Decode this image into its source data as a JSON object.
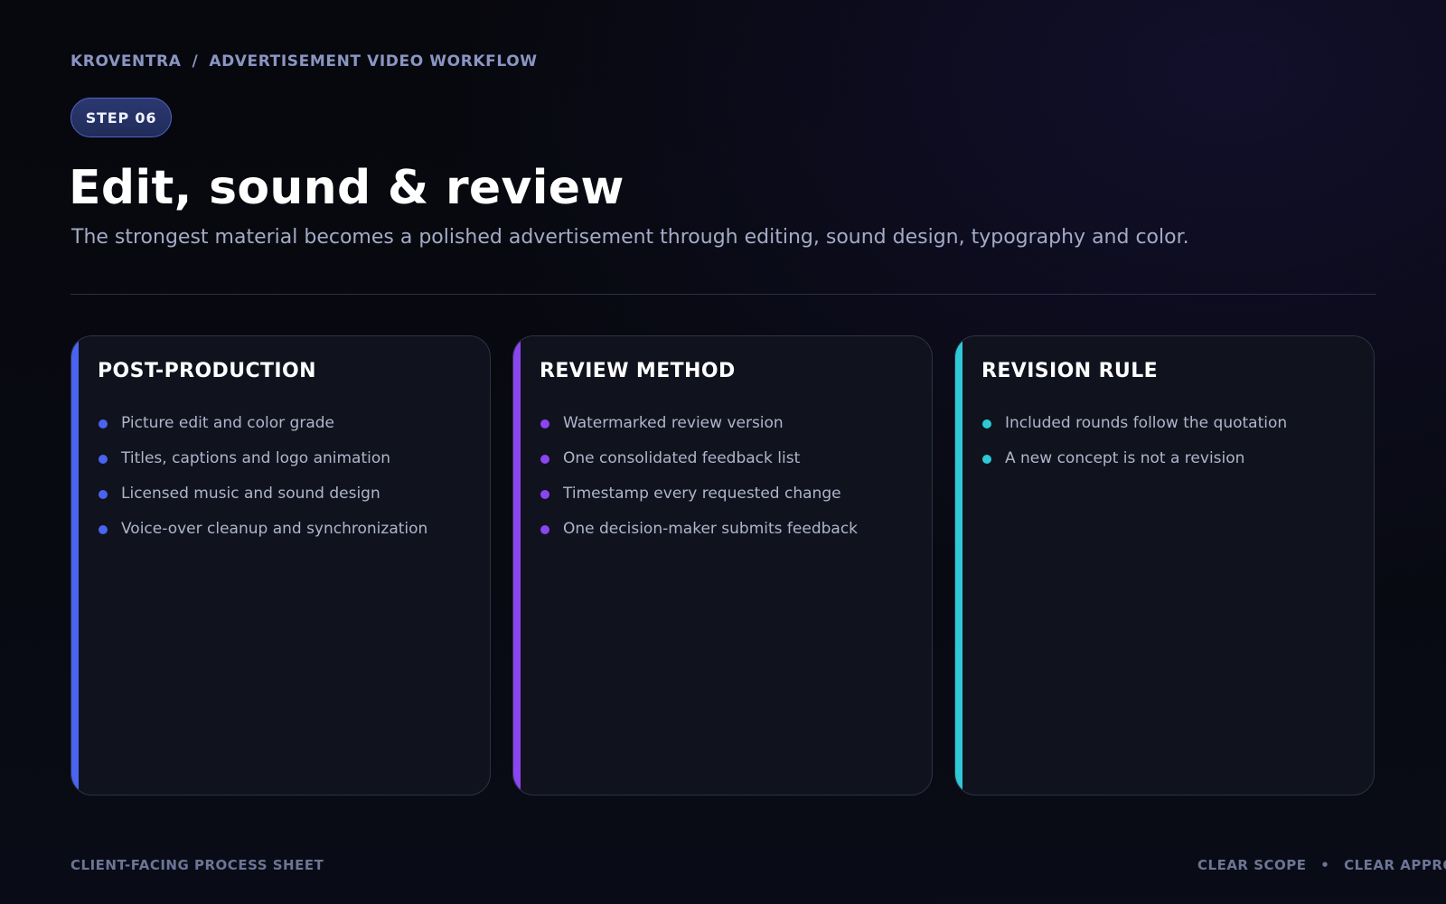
{
  "header": {
    "brand": "KROVENTRA",
    "separator": "/",
    "section": "ADVERTISEMENT VIDEO WORKFLOW",
    "step_badge": "STEP 06",
    "title": "Edit, sound & review",
    "subtitle": "The strongest material becomes a polished advertisement through editing, sound design, typography and color."
  },
  "cards": [
    {
      "title": "POST-PRODUCTION",
      "accent_color": "#4a63f0",
      "items": [
        "Picture edit and color grade",
        "Titles, captions and logo animation",
        "Licensed music and sound design",
        "Voice-over cleanup and synchronization"
      ]
    },
    {
      "title": "REVIEW METHOD",
      "accent_color": "#8b45f0",
      "items": [
        "Watermarked review version",
        "One consolidated feedback list",
        "Timestamp every requested change",
        "One decision-maker submits feedback"
      ]
    },
    {
      "title": "REVISION RULE",
      "accent_color": "#2ec9d6",
      "items": [
        "Included rounds follow the quotation",
        "A new concept is not a revision"
      ]
    }
  ],
  "footer": {
    "left": "CLIENT-FACING PROCESS SHEET",
    "right_item_1": "CLEAR SCOPE",
    "bullet": "•",
    "right_item_2": "CLEAR APPRO"
  }
}
